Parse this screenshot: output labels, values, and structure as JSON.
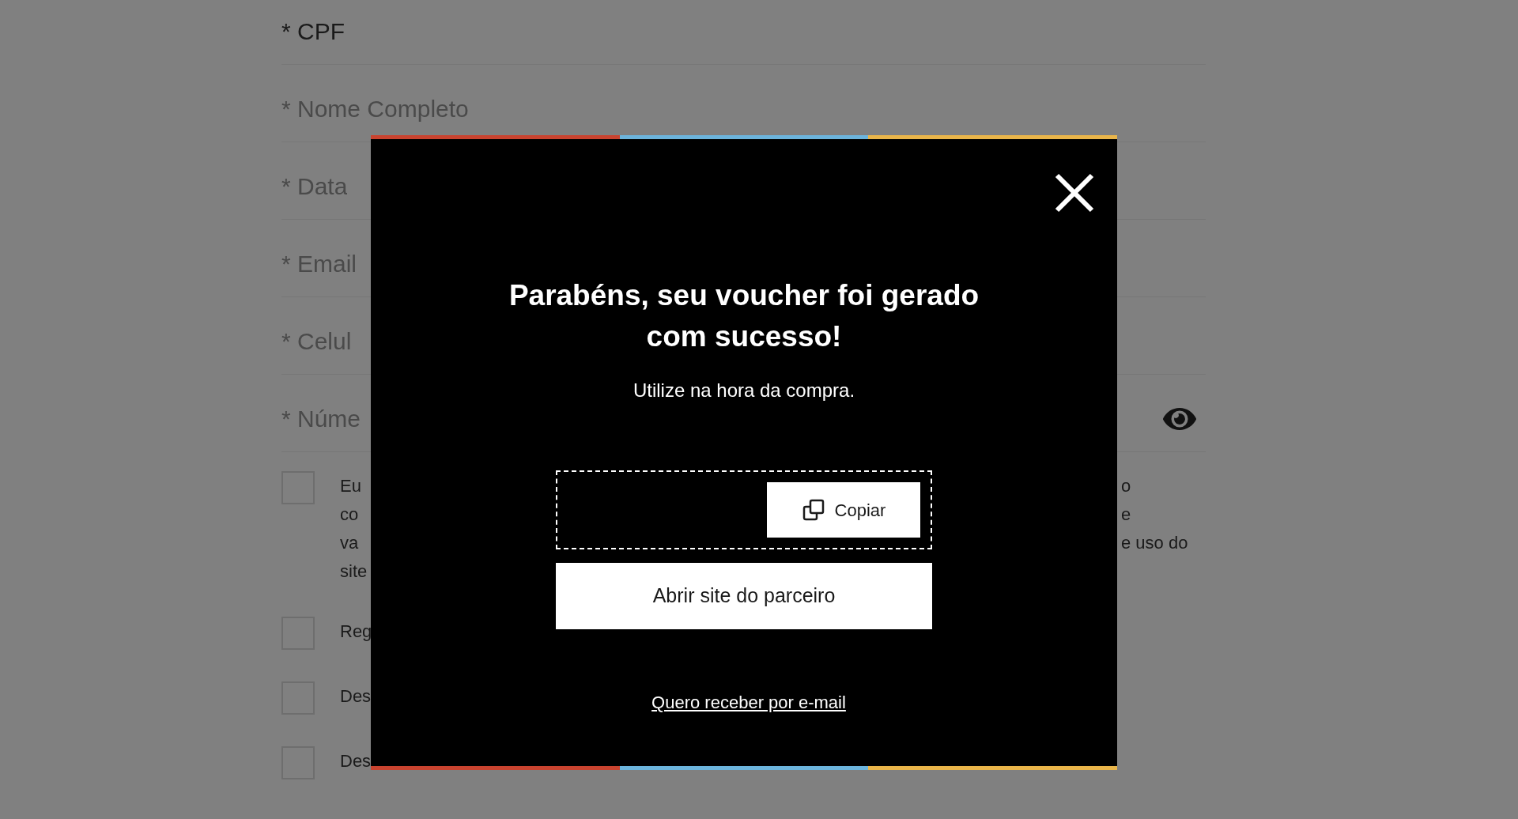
{
  "form": {
    "fields": [
      {
        "kind": "label",
        "label": "* CPF"
      },
      {
        "kind": "text",
        "placeholder": "* Nome Completo"
      },
      {
        "kind": "text",
        "placeholder": "* Data"
      },
      {
        "kind": "text",
        "placeholder": "* Email"
      },
      {
        "kind": "text",
        "placeholder": "* Celul"
      },
      {
        "kind": "password",
        "placeholder": "* Núme"
      }
    ],
    "checkboxes": [
      {
        "checked": false,
        "lines": [
          {
            "left": "Eu",
            "right": "o"
          },
          {
            "left": "co",
            "right": "e"
          },
          {
            "left": "va",
            "right": "e uso do"
          },
          {
            "left": "site"
          }
        ]
      },
      {
        "checked": false,
        "lines": [
          {
            "left": "Reg"
          }
        ]
      },
      {
        "checked": false,
        "lines": [
          {
            "left": "Des"
          }
        ]
      },
      {
        "checked": false,
        "lines": [
          {
            "left": "Des"
          }
        ]
      }
    ]
  },
  "modal": {
    "title": "Parabéns, seu voucher foi gerado com sucesso!",
    "subtitle": "Utilize na hora da compra.",
    "copy_button": "Copiar",
    "primary_button": "Abrir site do parceiro",
    "email_link": "Quero receber por e-mail"
  }
}
